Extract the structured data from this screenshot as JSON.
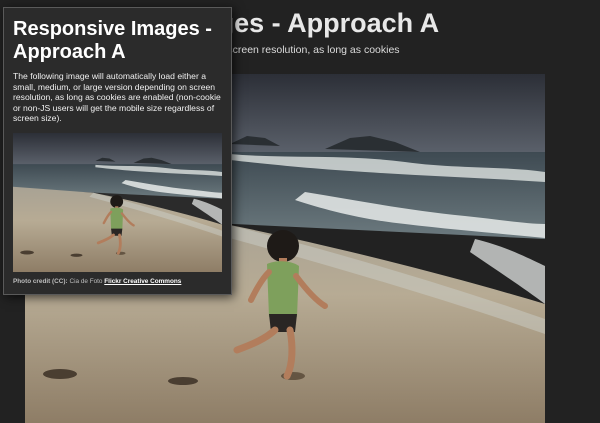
{
  "desktop_view": {
    "title_partial": "Responsive Images - Approach A",
    "description_visible": "small, medium, or large version depending on screen resolution, as long as cookies\ne mobile size regardless of screen size)."
  },
  "mobile_view": {
    "title": "Responsive Images - Approach A",
    "description": "The following image will automatically load either a small, medium, or large version depending on screen resolution, as long as cookies are enabled (non-cookie or non-JS users will get the mobile size regardless of screen size).",
    "credit_label": "Photo credit (CC):",
    "credit_author": "Cia de Foto",
    "credit_link": "Flickr Creative Commons"
  },
  "photo": {
    "subject": "child-running-on-beach-photo",
    "colors": {
      "sky": "#3c4048",
      "sea": "#55616a",
      "foam": "#cfd3d1",
      "sand": "#b8ab94",
      "shirt": "#7ea05c"
    }
  }
}
